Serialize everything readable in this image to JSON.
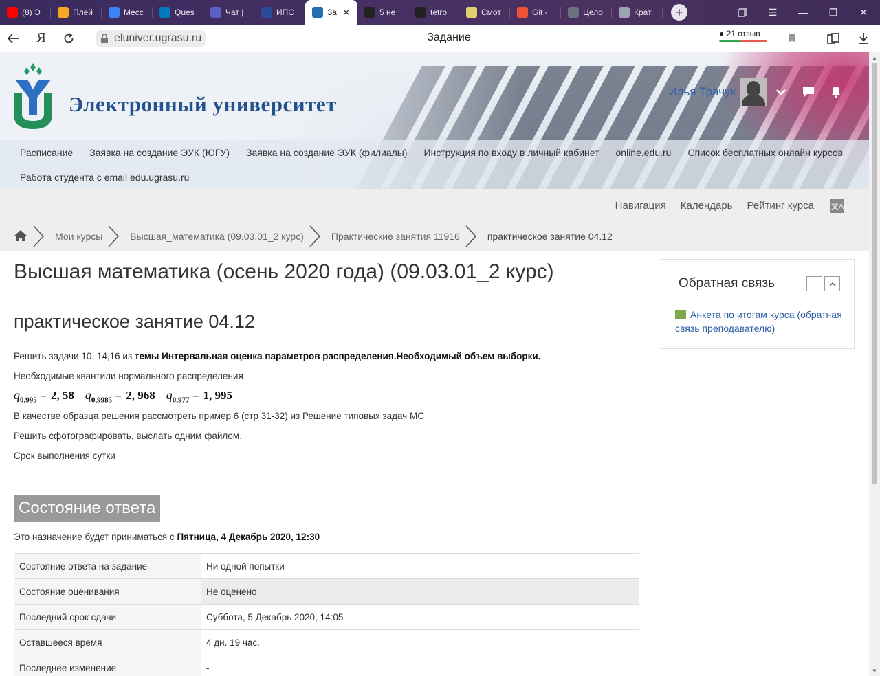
{
  "browser": {
    "tabs": [
      {
        "title": "(8) Э",
        "icon": "youtube-icon",
        "color": "#ff0000"
      },
      {
        "title": "Плей",
        "icon": "music-icon",
        "color": "#f5a623"
      },
      {
        "title": "Месс",
        "icon": "messenger-icon",
        "color": "#3b82f6"
      },
      {
        "title": "Ques",
        "icon": "trello-icon",
        "color": "#0079bf"
      },
      {
        "title": "Чат |",
        "icon": "teams-icon",
        "color": "#5b5fc7"
      },
      {
        "title": "ИПС",
        "icon": "ips-icon",
        "color": "#2c4a9a"
      },
      {
        "title": "За",
        "icon": "page-icon",
        "color": "#1f6fb2",
        "active": true
      },
      {
        "title": "5 нe",
        "icon": "spark-icon",
        "color": "#222222"
      },
      {
        "title": "tetro",
        "icon": "github-icon",
        "color": "#222222"
      },
      {
        "title": "Смот",
        "icon": "video-icon",
        "color": "#e0d070"
      },
      {
        "title": "Git -",
        "icon": "git-icon",
        "color": "#f05033"
      },
      {
        "title": "Цело",
        "icon": "doc-icon",
        "color": "#6b7280"
      },
      {
        "title": "Крат",
        "icon": "grid-icon",
        "color": "#9ca3af"
      }
    ],
    "url": "eluniver.ugrasu.ru",
    "page_title": "Задание",
    "reviews": "21 отзыв"
  },
  "site": {
    "title": "Электронный университет",
    "user_name": "Илья Трачук",
    "menu_row1": [
      "Расписание",
      "Заявка на создание ЭУК (ЮГУ)",
      "Заявка на создание ЭУК (филиалы)",
      "Инструкция по входу в личный кабинет",
      "online.edu.ru",
      "Список бесплатных онлайн курсов"
    ],
    "menu_row2": [
      "Работа студента с email edu.ugrasu.ru"
    ],
    "subnav": [
      "Навигация",
      "Календарь",
      "Рейтинг курса"
    ],
    "breadcrumbs": [
      "Мои курсы",
      "Высшая_математика (09.03.01_2 курс)",
      "Практические занятия 11916",
      "практическое занятие 04.12"
    ]
  },
  "main": {
    "course_title": "Высшая математика (осень 2020 года) (09.03.01_2 курс)",
    "lesson_title": "практическое занятие 04.12",
    "task_prefix": "Решить задачи 10, 14,16 из ",
    "task_bold": "темы  Интервальная оценка параметров распределения.Необходимый объем выборки.",
    "quantiles_label": "Необходимые квантили нормального распределения",
    "quantiles": [
      {
        "sub": "0,995",
        "value": "2, 58"
      },
      {
        "sub": "0,9985",
        "value": "2, 968"
      },
      {
        "sub": "0,977",
        "value": "1, 995"
      }
    ],
    "sample_text": "В качестве образца решения рассмотреть пример 6 (стр 31-32) из Решение типовых задач МС",
    "photo_text": "Решить сфотографировать, выслать одним файлом.",
    "deadline_text": "Срок выполнения сутки",
    "status_heading": "Состояние ответа",
    "accept_prefix": "Это назначение будет приниматься с ",
    "accept_date": "Пятница, 4 Декабрь 2020, 12:30",
    "status_rows": [
      {
        "key": "Состояние ответа на задание",
        "value": "Ни одной попытки"
      },
      {
        "key": "Состояние оценивания",
        "value": "Не оценено"
      },
      {
        "key": "Последний срок сдачи",
        "value": "Суббота, 5 Декабрь 2020, 14:05"
      },
      {
        "key": "Оставшееся время",
        "value": "4 дн. 19 час."
      },
      {
        "key": "Последнее изменение",
        "value": "-"
      }
    ]
  },
  "feedback_block": {
    "title": "Обратная связь",
    "link": "Анкета по итогам курса (обратная связь преподавателю)"
  }
}
